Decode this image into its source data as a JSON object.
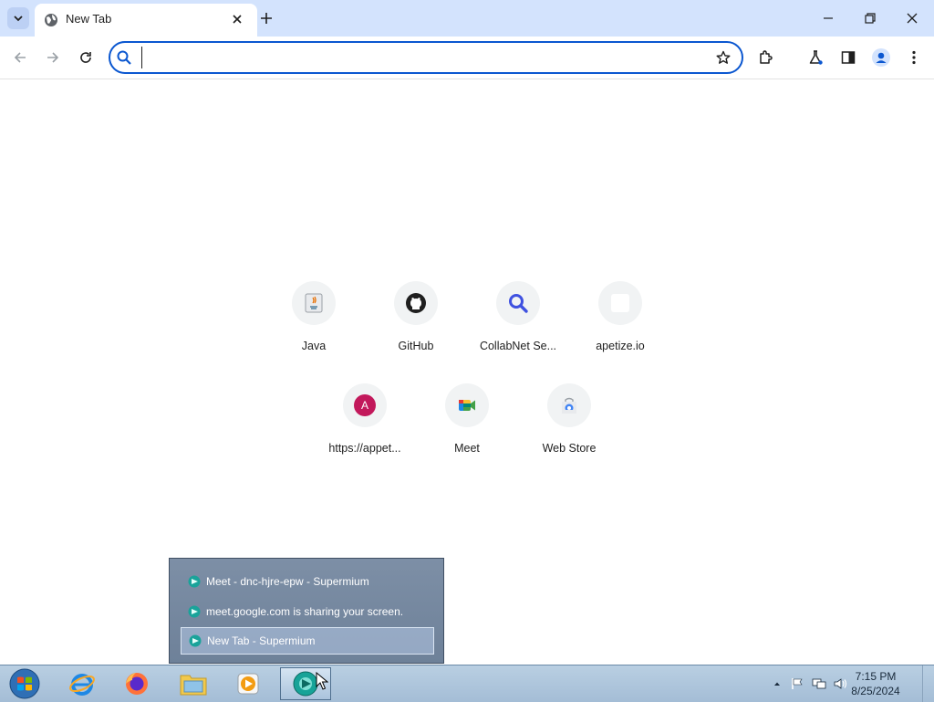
{
  "browser": {
    "tab": {
      "title": "New Tab"
    },
    "omnibox": {
      "value": "",
      "placeholder": ""
    }
  },
  "shortcuts": [
    {
      "label": "Java",
      "icon": "java-icon"
    },
    {
      "label": "GitHub",
      "icon": "github-icon"
    },
    {
      "label": "CollabNet Se...",
      "icon": "magnifier-icon"
    },
    {
      "label": "apetize.io",
      "icon": "blank-icon"
    },
    {
      "label": "https://appet...",
      "icon": "letter-avatar-icon",
      "avatar_letter": "A",
      "avatar_color": "#c2185b"
    },
    {
      "label": "Meet",
      "icon": "google-meet-icon"
    },
    {
      "label": "Web Store",
      "icon": "web-store-icon"
    }
  ],
  "jumplist": {
    "items": [
      {
        "label": "Meet - dnc-hjre-epw - Supermium"
      },
      {
        "label": "meet.google.com is sharing your screen."
      },
      {
        "label": "New Tab - Supermium"
      }
    ]
  },
  "taskbar": {
    "clock": {
      "time": "7:15 PM",
      "date": "8/25/2024"
    }
  },
  "colors": {
    "accent": "#0b57d0",
    "tabstrip": "#d3e3fd",
    "taskbar": "#a4bdd6"
  }
}
